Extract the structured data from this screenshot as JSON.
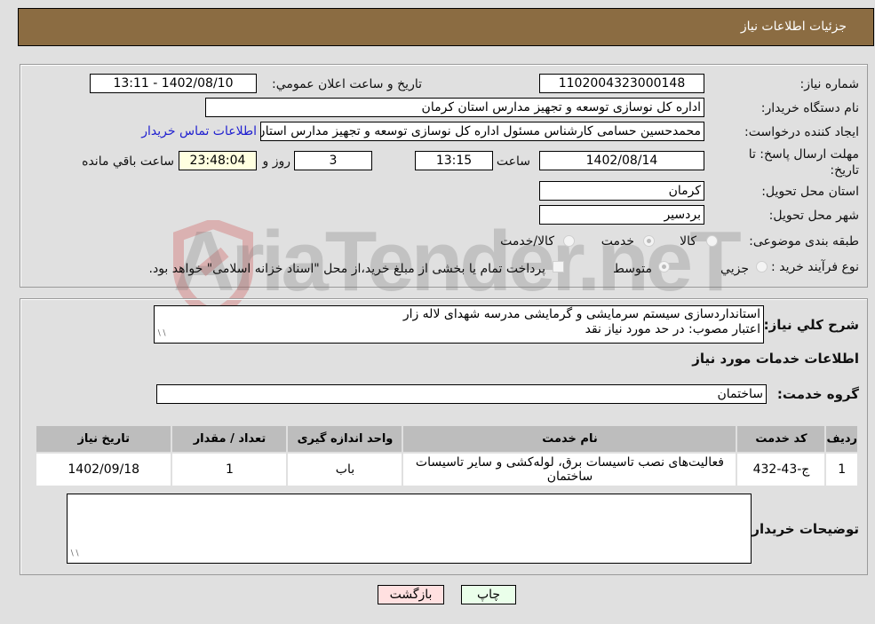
{
  "header": {
    "title": "جزئیات اطلاعات نیاز"
  },
  "form": {
    "need_number": {
      "label": "شماره نیاز:",
      "value": "1102004323000148"
    },
    "announce_datetime": {
      "label": "تاریخ و ساعت اعلان عمومي:",
      "value": "1402/08/10 - 13:11"
    },
    "buyer_org": {
      "label": "نام دستگاه خریدار:",
      "value": "اداره کل نوسازی  توسعه و تجهیز مدارس استان کرمان"
    },
    "requester": {
      "label": "ایجاد کننده درخواست:",
      "value": "محمدحسین حسامی کارشناس مسئول اداره کل نوسازی  توسعه و تجهیز مدارس استان کرمان",
      "contact_link": "اطلاعات تماس خریدار"
    },
    "deadline": {
      "label": "مهلت ارسال پاسخ: تا تاریخ:",
      "date": "1402/08/14",
      "time_label": "ساعت",
      "time": "13:15",
      "days": "3",
      "days_label": "روز و",
      "remaining": "23:48:04",
      "remaining_label": "ساعت باقي مانده"
    },
    "province": {
      "label": "استان محل تحویل:",
      "value": "کرمان"
    },
    "city": {
      "label": "شهر محل تحویل:",
      "value": "بردسیر"
    },
    "category": {
      "label": "طبقه بندی موضوعی:",
      "options": [
        "کالا",
        "خدمت",
        "کالا/خدمت"
      ],
      "selected": "خدمت"
    },
    "purchase_type": {
      "label": "نوع فرآیند خرید :",
      "options": [
        "جزيي",
        "متوسط"
      ],
      "selected": "متوسط",
      "treasury_note": "پرداخت تمام یا بخشی از مبلغ خرید،از محل \"اسناد خزانه اسلامی\" خواهد بود."
    }
  },
  "description": {
    "label": "شرح کلي نياز:",
    "lines": [
      "استانداردسازی سیستم سرمایشی و گرمایشی مدرسه شهدای لاله زار",
      "اعتبار مصوب: در حد مورد نیاز نقد"
    ]
  },
  "services": {
    "section_title": "اطلاعات خدمات مورد نياز",
    "group_label": "گروه خدمت:",
    "group_value": "ساختمان",
    "table": {
      "headers": [
        "رديف",
        "کد خدمت",
        "نام خدمت",
        "واحد اندازه گیری",
        "تعداد / مقدار",
        "تاریخ نیاز"
      ],
      "rows": [
        [
          "1",
          "ج-43-432",
          "فعالیت‌های نصب تاسیسات برق، لوله‌کشی و سایر تاسیسات ساختمان",
          "باب",
          "1",
          "1402/09/18"
        ]
      ]
    }
  },
  "buyer_notes": {
    "label": "توضیحات خریدار:",
    "value": ""
  },
  "buttons": {
    "print": "چاپ",
    "back": "بازگشت"
  },
  "colors": {
    "header_bg": "#8b6c42",
    "print_bg": "#eaffea",
    "back_bg": "#ffe0e0",
    "link": "#2020d0"
  },
  "watermark": {
    "text": "AriaTender.neT"
  }
}
